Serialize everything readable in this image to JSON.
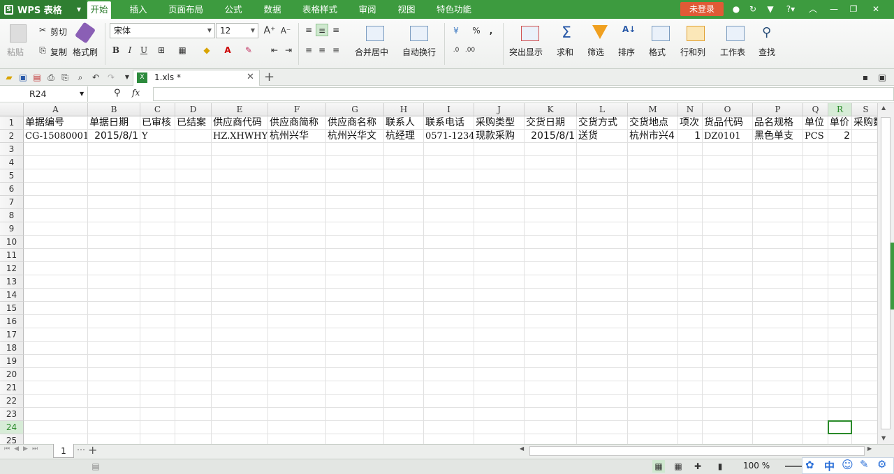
{
  "app": {
    "name": "WPS 表格"
  },
  "menu": {
    "tabs": [
      "开始",
      "插入",
      "页面布局",
      "公式",
      "数据",
      "表格样式",
      "审阅",
      "视图",
      "特色功能"
    ],
    "login_label": "未登录"
  },
  "ribbon": {
    "paste_label": "粘贴",
    "cut_label": "剪切",
    "copy_label": "复制",
    "format_painter_label": "格式刷",
    "font_name": "宋体",
    "font_size": "12",
    "merge_label": "合并居中",
    "wrap_label": "自动换行",
    "highlight_label": "突出显示",
    "sum_label": "求和",
    "filter_label": "筛选",
    "sort_label": "排序",
    "format_label": "格式",
    "rowcol_label": "行和列",
    "sheet_label": "工作表",
    "find_label": "查找"
  },
  "document": {
    "tab_title": "1.xls *"
  },
  "formula_bar": {
    "name_box": "R24",
    "fx": "fx"
  },
  "sheet": {
    "columns": [
      "A",
      "B",
      "C",
      "D",
      "E",
      "F",
      "G",
      "H",
      "I",
      "J",
      "K",
      "L",
      "M",
      "N",
      "O",
      "P",
      "Q",
      "R",
      "S"
    ],
    "rows": [
      [
        "单据编号",
        "单据日期",
        "已审核",
        "已结案",
        "供应商代码",
        "供应商简称",
        "供应商名称",
        "联系人",
        "联系电话",
        "采购类型",
        "交货日期",
        "交货方式",
        "交货地点",
        "项次",
        "货品代码",
        "品名规格",
        "单位",
        "单价",
        "采购数"
      ],
      [
        "CG-15080001",
        "2015/8/1",
        "Y",
        "",
        "HZ.XHWHY",
        "杭州兴华",
        "杭州兴华文",
        "杭经理",
        "0571-1234",
        "现款采购",
        "2015/8/1",
        "送货",
        "杭州市兴4",
        "1",
        "DZ0101",
        "黑色单支",
        "PCS",
        "2",
        ""
      ]
    ],
    "row_numbers": [
      "1",
      "2",
      "3",
      "4",
      "5",
      "6",
      "7",
      "8",
      "9",
      "10",
      "11",
      "12",
      "13",
      "14",
      "15",
      "16",
      "17",
      "18",
      "19",
      "20",
      "21",
      "22",
      "23",
      "24",
      "25"
    ],
    "selected_cell": "R24",
    "sheet_tab": "1"
  },
  "status": {
    "zoom": "100 %",
    "ime_label": "中"
  },
  "colors": {
    "brand_green": "#3d9b3f",
    "login_red": "#e05a36",
    "selection_green": "#2a8a2a"
  }
}
